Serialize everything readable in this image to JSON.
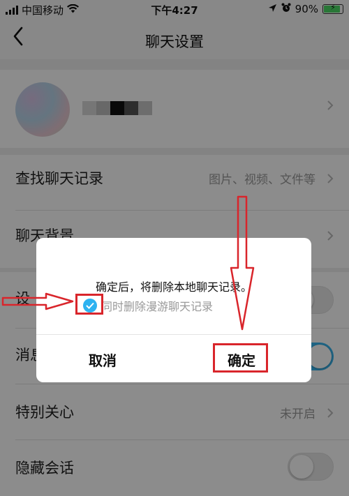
{
  "status_bar": {
    "carrier": "中国移动",
    "time": "下午4:27",
    "battery_text": "90%",
    "battery_level": 0.9,
    "battery_color": "#4cd964"
  },
  "nav": {
    "back_icon": "chevron-left-icon",
    "title": "聊天设置"
  },
  "settings": {
    "search_history": {
      "label": "查找聊天记录",
      "value": "图片、视频、文件等"
    },
    "chat_background": {
      "label": "聊天背景"
    },
    "row_partial_1": {
      "label": "设"
    },
    "row_partial_2": {
      "label": "消息"
    },
    "special_care": {
      "label": "特别关心",
      "value": "未开启"
    },
    "hide_chat": {
      "label": "隐藏会话",
      "toggle_on": false
    }
  },
  "dialog": {
    "message": "确定后，将删除本地聊天记录。",
    "checkbox_label": "同时删除漫游聊天记录",
    "checkbox_checked": true,
    "cancel_label": "取消",
    "confirm_label": "确定"
  },
  "colors": {
    "accent": "#2db2f0",
    "annotation": "#d9252b",
    "toggle_on": "#3ab7f0"
  }
}
